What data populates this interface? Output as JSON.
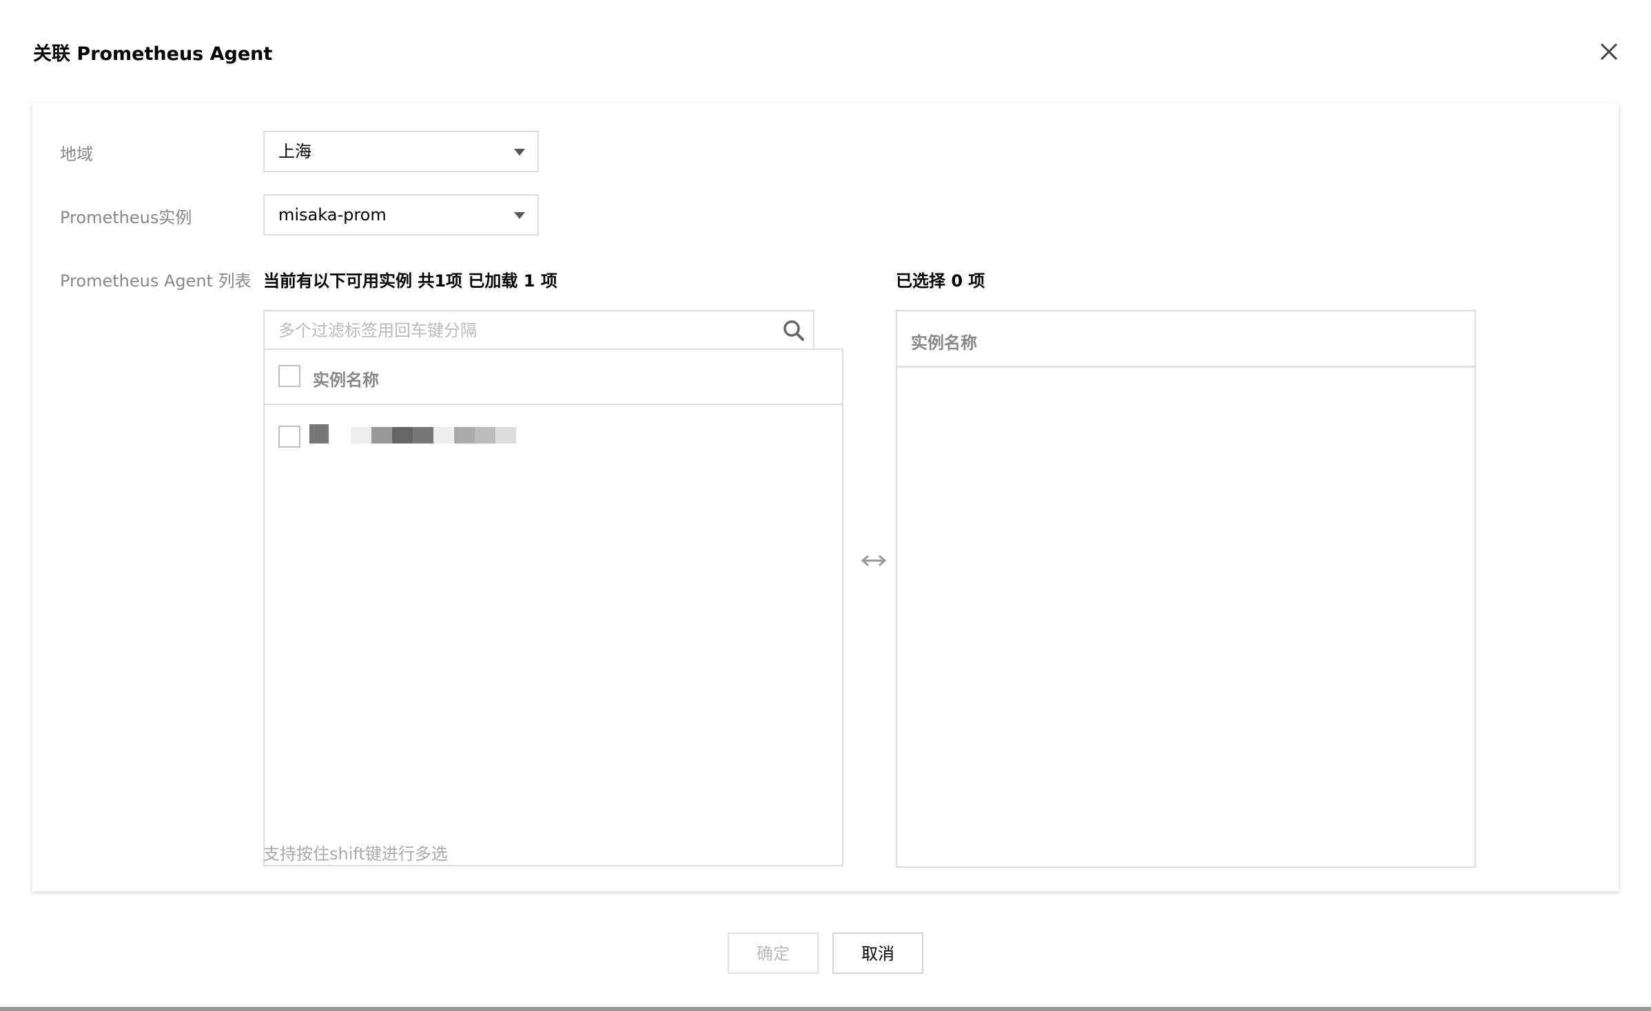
{
  "dialog": {
    "title": "关联 Prometheus Agent"
  },
  "form": {
    "region_label": "地域",
    "region_value": "上海",
    "instance_label": "Prometheus实例",
    "instance_value": "misaka-prom",
    "agent_list_label": "Prometheus Agent 列表"
  },
  "transfer": {
    "source_heading": "当前有以下可用实例 共1项 已加载 1 项",
    "target_heading": "已选择 0 项",
    "search_placeholder": "多个过滤标签用回车键分隔",
    "column_header": "实例名称",
    "hint": "支持按住shift键进行多选"
  },
  "footer": {
    "confirm_label": "确定",
    "cancel_label": "取消"
  },
  "icons": {
    "close": "close-icon",
    "search": "search-icon",
    "dropdown": "caret-down-icon",
    "transfer": "bidirectional-arrow-icon"
  },
  "colors": {
    "border": "#dcdcdc",
    "label_gray": "#888888",
    "disabled_text": "#bbbbbb"
  }
}
